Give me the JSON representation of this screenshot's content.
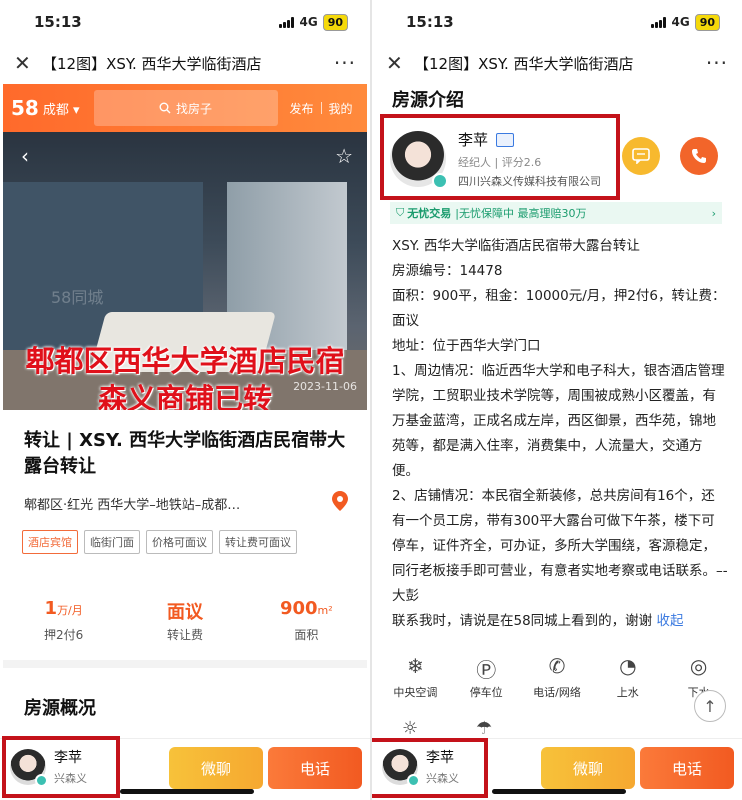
{
  "status": {
    "time": "15:13",
    "network": "4G",
    "battery": "90"
  },
  "nav": {
    "close": "✕",
    "title": "【12图】XSY. 西华大学临街酒店",
    "more": "···"
  },
  "topbar": {
    "logo": "58",
    "city": "成都",
    "search_placeholder": "找房子",
    "publish": "发布",
    "mine": "我的"
  },
  "photo": {
    "watermark": "58同城",
    "date": "2023-11-06",
    "overlay_line1": "郫都区西华大学酒店民宿",
    "overlay_line2": "森义商铺已转"
  },
  "listing": {
    "title": "转让 | XSY. 西华大学临街酒店民宿带大露台转让",
    "address": "郫都区·红光 西华大学–地铁站–成都…",
    "tags": [
      "酒店宾馆",
      "临街门面",
      "价格可面议",
      "转让费可面议"
    ],
    "rent_value": "1",
    "rent_unit": "万/月",
    "rent_label": "押2付6",
    "fee_value": "面议",
    "fee_label": "转让费",
    "area_value": "900",
    "area_unit": "m²",
    "area_label": "面积"
  },
  "section_overview": "房源概况",
  "section_intro": "房源介绍",
  "agent": {
    "name": "李苹",
    "role": "经纪人",
    "rating": "评分2.6",
    "company": "四川兴森义传媒科技有限公司",
    "company_short": "兴森义"
  },
  "guarantee": {
    "brand": "无忧交易",
    "text": "|无忧保障中 最高理赔30万"
  },
  "description": [
    "XSY. 西华大学临街酒店民宿带大露台转让",
    "房源编号：14478",
    "面积：900平，租金：10000元/月，押2付6，转让费：面议",
    "地址：位于西华大学门口",
    "1、周边情况：临近西华大学和电子科大，银杏酒店管理学院，工贸职业技术学院等，周围被成熟小区覆盖，有万基金蓝湾，正成名成左岸，西区御景，西华苑，锦地苑等，都是满入住率，消费集中，人流量大，交通方便。",
    "2、店铺情况：本民宿全新装修，总共房间有16个，还有一个员工房，带有300平大露台可做下午茶，楼下可停车，证件齐全，可办证，多所大学围绕，客源稳定，同行老板接手即可营业，有意者实地考察或电话联系。–-大彭"
  ],
  "contact_line": "联系我时，请说是在58同城上看到的，谢谢",
  "collapse": "收起",
  "facilities": [
    "中央空调",
    "停车位",
    "电话/网络",
    "上水",
    "下水"
  ],
  "buttons": {
    "chat": "微聊",
    "call": "电话"
  }
}
